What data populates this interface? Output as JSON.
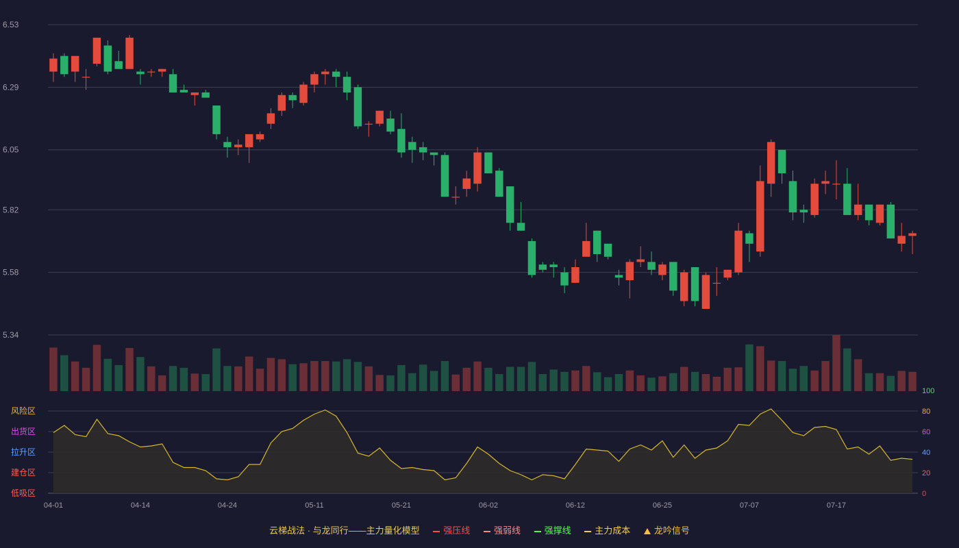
{
  "chart_data": [
    {
      "type": "candlestick",
      "price_axis": {
        "ticks": [
          6.53,
          6.29,
          6.05,
          5.82,
          5.58,
          5.34
        ]
      },
      "x_labels": [
        "04-01",
        "04-14",
        "04-24",
        "05-11",
        "05-21",
        "06-02",
        "06-12",
        "06-25",
        "07-07",
        "07-17"
      ],
      "label_indices": [
        0,
        8,
        16,
        24,
        32,
        40,
        48,
        56,
        64,
        72
      ],
      "grid": true,
      "candles": [
        [
          6.35,
          6.4,
          6.42,
          6.31
        ],
        [
          6.41,
          6.34,
          6.42,
          6.33
        ],
        [
          6.35,
          6.41,
          6.41,
          6.31
        ],
        [
          6.33,
          6.33,
          6.36,
          6.28
        ],
        [
          6.38,
          6.48,
          6.48,
          6.37
        ],
        [
          6.45,
          6.35,
          6.47,
          6.34
        ],
        [
          6.39,
          6.36,
          6.43,
          6.36
        ],
        [
          6.36,
          6.48,
          6.49,
          6.36
        ],
        [
          6.35,
          6.34,
          6.36,
          6.3
        ],
        [
          6.35,
          6.35,
          6.36,
          6.33
        ],
        [
          6.35,
          6.36,
          6.36,
          6.33
        ],
        [
          6.34,
          6.27,
          6.36,
          6.27
        ],
        [
          6.28,
          6.27,
          6.3,
          6.27
        ],
        [
          6.26,
          6.27,
          6.27,
          6.22
        ],
        [
          6.27,
          6.25,
          6.28,
          6.25
        ],
        [
          6.22,
          6.11,
          6.22,
          6.09
        ],
        [
          6.08,
          6.06,
          6.1,
          6.02
        ],
        [
          6.06,
          6.07,
          6.09,
          6.03
        ],
        [
          6.06,
          6.11,
          6.11,
          6.0
        ],
        [
          6.09,
          6.11,
          6.12,
          6.08
        ],
        [
          6.15,
          6.19,
          6.21,
          6.13
        ],
        [
          6.2,
          6.26,
          6.27,
          6.18
        ],
        [
          6.26,
          6.24,
          6.27,
          6.21
        ],
        [
          6.23,
          6.3,
          6.31,
          6.22
        ],
        [
          6.3,
          6.34,
          6.35,
          6.27
        ],
        [
          6.34,
          6.35,
          6.36,
          6.3
        ],
        [
          6.35,
          6.33,
          6.36,
          6.29
        ],
        [
          6.33,
          6.27,
          6.35,
          6.24
        ],
        [
          6.29,
          6.14,
          6.3,
          6.13
        ],
        [
          6.15,
          6.15,
          6.16,
          6.1
        ],
        [
          6.15,
          6.2,
          6.2,
          6.14
        ],
        [
          6.17,
          6.12,
          6.2,
          6.11
        ],
        [
          6.13,
          6.04,
          6.19,
          6.02
        ],
        [
          6.08,
          6.05,
          6.1,
          6.0
        ],
        [
          6.06,
          6.04,
          6.08,
          6.01
        ],
        [
          6.04,
          6.03,
          6.04,
          5.99
        ],
        [
          6.03,
          5.87,
          6.04,
          5.87
        ],
        [
          5.87,
          5.87,
          5.91,
          5.84
        ],
        [
          5.9,
          5.94,
          5.97,
          5.87
        ],
        [
          5.92,
          6.04,
          6.06,
          5.89
        ],
        [
          6.04,
          5.96,
          6.04,
          5.96
        ],
        [
          5.97,
          5.87,
          5.98,
          5.87
        ],
        [
          5.91,
          5.77,
          5.91,
          5.74
        ],
        [
          5.77,
          5.74,
          5.85,
          5.74
        ],
        [
          5.7,
          5.57,
          5.71,
          5.56
        ],
        [
          5.61,
          5.59,
          5.62,
          5.58
        ],
        [
          5.61,
          5.6,
          5.62,
          5.56
        ],
        [
          5.58,
          5.53,
          5.6,
          5.5
        ],
        [
          5.54,
          5.6,
          5.63,
          5.54
        ],
        [
          5.64,
          5.7,
          5.77,
          5.64
        ],
        [
          5.74,
          5.65,
          5.74,
          5.62
        ],
        [
          5.69,
          5.64,
          5.69,
          5.63
        ],
        [
          5.57,
          5.56,
          5.59,
          5.53
        ],
        [
          5.55,
          5.62,
          5.63,
          5.48
        ],
        [
          5.62,
          5.63,
          5.68,
          5.6
        ],
        [
          5.62,
          5.59,
          5.66,
          5.57
        ],
        [
          5.57,
          5.61,
          5.62,
          5.55
        ],
        [
          5.62,
          5.51,
          5.62,
          5.49
        ],
        [
          5.47,
          5.58,
          5.59,
          5.45
        ],
        [
          5.6,
          5.47,
          5.6,
          5.45
        ],
        [
          5.44,
          5.57,
          5.58,
          5.44
        ],
        [
          5.54,
          5.54,
          5.6,
          5.49
        ],
        [
          5.56,
          5.59,
          5.59,
          5.55
        ],
        [
          5.58,
          5.74,
          5.77,
          5.57
        ],
        [
          5.73,
          5.69,
          5.74,
          5.62
        ],
        [
          5.66,
          5.93,
          5.99,
          5.64
        ],
        [
          5.92,
          6.08,
          6.09,
          5.87
        ],
        [
          6.05,
          5.96,
          6.05,
          5.92
        ],
        [
          5.93,
          5.81,
          5.97,
          5.78
        ],
        [
          5.82,
          5.81,
          5.84,
          5.77
        ],
        [
          5.8,
          5.92,
          5.94,
          5.79
        ],
        [
          5.92,
          5.93,
          5.97,
          5.88
        ],
        [
          5.92,
          5.92,
          6.01,
          5.86
        ],
        [
          5.92,
          5.8,
          5.98,
          5.8
        ],
        [
          5.8,
          5.84,
          5.92,
          5.78
        ],
        [
          5.84,
          5.78,
          5.84,
          5.76
        ],
        [
          5.77,
          5.84,
          5.84,
          5.76
        ],
        [
          5.84,
          5.71,
          5.85,
          5.71
        ],
        [
          5.69,
          5.72,
          5.77,
          5.66
        ],
        [
          5.72,
          5.73,
          5.74,
          5.65
        ]
      ],
      "volume": [
        97,
        80,
        66,
        52,
        103,
        72,
        58,
        96,
        76,
        55,
        35,
        56,
        52,
        39,
        38,
        95,
        56,
        55,
        77,
        50,
        74,
        71,
        60,
        62,
        67,
        67,
        66,
        71,
        65,
        55,
        36,
        35,
        58,
        40,
        59,
        45,
        67,
        37,
        52,
        66,
        52,
        38,
        54,
        54,
        65,
        38,
        48,
        43,
        46,
        56,
        42,
        31,
        38,
        46,
        35,
        30,
        33,
        40,
        54,
        43,
        38,
        32,
        52,
        53,
        104,
        100,
        68,
        67,
        50,
        56,
        46,
        67,
        125,
        95,
        71,
        40,
        40,
        34,
        45,
        43
      ]
    },
    {
      "type": "line",
      "y_ticks": [
        0,
        20,
        40,
        60,
        80,
        100
      ],
      "zone_labels": [
        "风险区",
        "出货区",
        "拉升区",
        "建仓区",
        "低吸区"
      ],
      "values": [
        59,
        66,
        57,
        55,
        72,
        58,
        56,
        50,
        45,
        46,
        48,
        30,
        25,
        25,
        22,
        14,
        13,
        16,
        28,
        28,
        49,
        60,
        63,
        71,
        77,
        81,
        75,
        59,
        39,
        36,
        44,
        32,
        24,
        25,
        23,
        22,
        13,
        15,
        29,
        45,
        38,
        29,
        22,
        18,
        13,
        18,
        17,
        14,
        28,
        43,
        42,
        41,
        31,
        43,
        47,
        42,
        51,
        35,
        47,
        34,
        42,
        44,
        51,
        67,
        66,
        77,
        82,
        71,
        59,
        56,
        64,
        65,
        62,
        43,
        45,
        38,
        46,
        32,
        34,
        33
      ]
    }
  ],
  "colors": {
    "background": "#1a1a2e",
    "up": "#e34c3d",
    "down": "#2ab06a",
    "up_volume": "#6a2e36",
    "down_volume": "#1f5142",
    "grid": "#3c3f50",
    "axis_text": "#9c9ca8",
    "oscillator_line": "#d6b82a",
    "oscillator_fill": "#2f2b2a",
    "zone_colors": [
      "#e8b23a",
      "#e24be6",
      "#5aa0ff",
      "#ff5b52",
      "#ff5b52"
    ],
    "tick_colors": [
      "#e24b4b",
      "#ff5b52",
      "#5aa0ff",
      "#e24be6",
      "#e8b23a",
      "#46e05a"
    ]
  },
  "legend": {
    "items": [
      {
        "label": "云梯战法 · 与龙同行——主力量化模型",
        "color": "#e8c85a",
        "icon": "none"
      },
      {
        "label": "强压线",
        "color": "#ff4b4b",
        "icon": "line"
      },
      {
        "label": "强弱线",
        "color": "#ff8a8a",
        "icon": "dash"
      },
      {
        "label": "强撑线",
        "color": "#4bff4b",
        "icon": "line"
      },
      {
        "label": "主力成本",
        "color": "#f0d04b",
        "icon": "dash"
      },
      {
        "label": "龙吟信号",
        "color": "#f0c040",
        "icon": "triangle"
      }
    ]
  }
}
